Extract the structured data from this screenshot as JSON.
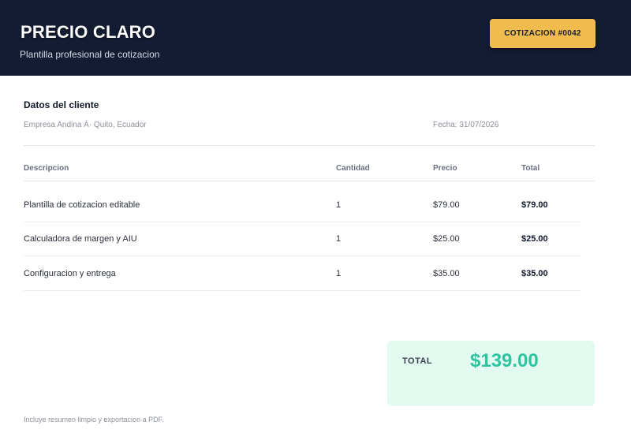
{
  "header": {
    "title": "PRECIO CLARO",
    "subtitle": "Plantilla profesional de cotizacion",
    "quote_badge": "COTIZACION #0042"
  },
  "client": {
    "heading": "Datos del cliente",
    "info": "Empresa Andina  Á· Quito, Ecuador",
    "date": "Fecha: 31/07/2026"
  },
  "table": {
    "headers": [
      "Descripcion",
      "Cantidad",
      "Precio",
      "Total"
    ],
    "rows": [
      {
        "description": "Plantilla de cotizacion editable",
        "quantity": "1",
        "price": "$79.00",
        "total": "$79.00"
      },
      {
        "description": "Calculadora de margen y AIU",
        "quantity": "1",
        "price": "$25.00",
        "total": "$25.00"
      },
      {
        "description": "Configuracion y entrega",
        "quantity": "1",
        "price": "$35.00",
        "total": "$35.00"
      }
    ]
  },
  "summary": {
    "label": "TOTAL",
    "amount": "$139.00"
  },
  "footer": {
    "note": "Incluye resumen limpio y exportacion a PDF."
  },
  "colors": {
    "header_bg": "#131c32",
    "badge": "#f0bc4d",
    "total_box": "#e3faf1",
    "total_amount": "#2dc5a0"
  }
}
